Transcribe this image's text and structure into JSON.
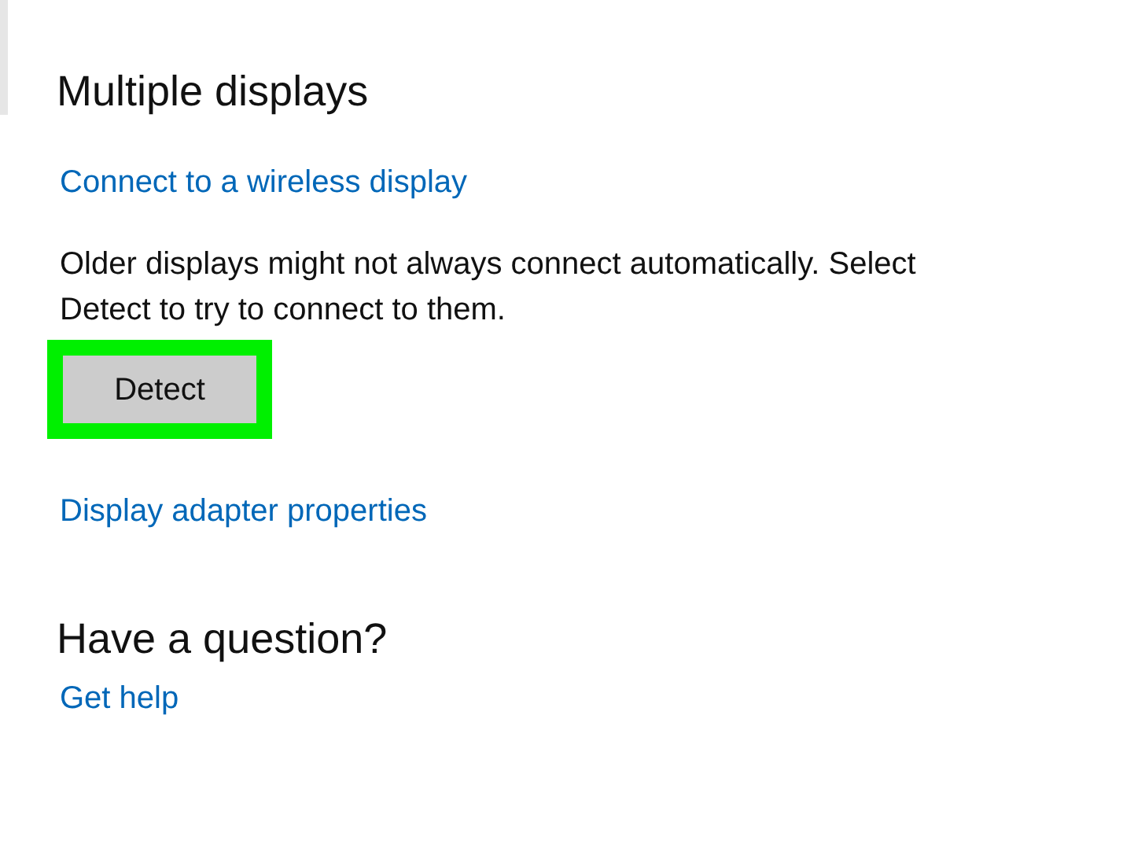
{
  "section_title": "Multiple displays",
  "wireless_link": "Connect to a wireless display",
  "description": "Older displays might not always connect automatically. Select Detect to try to connect to them.",
  "detect_button": {
    "label": "Detect",
    "highlighted": true
  },
  "adapter_link": "Display adapter properties",
  "help_title": "Have a question?",
  "help_link": "Get help"
}
